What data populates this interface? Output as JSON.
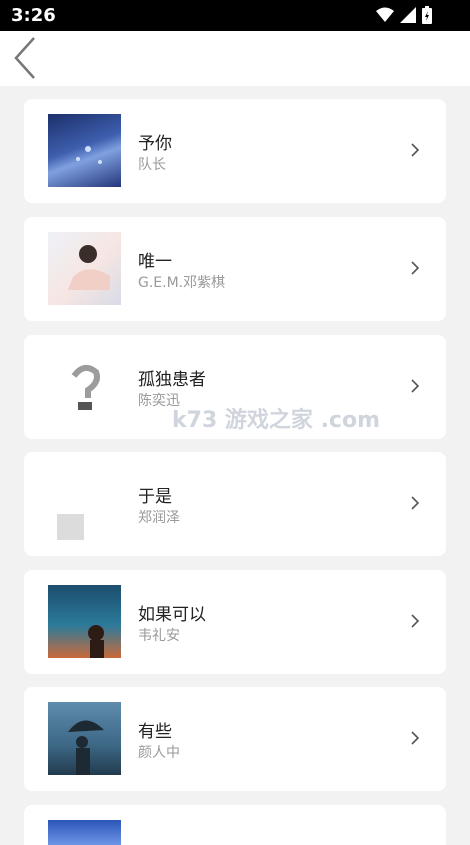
{
  "status": {
    "time": "3:26"
  },
  "songs": [
    {
      "title": "予你",
      "artist": "队长"
    },
    {
      "title": "唯一",
      "artist": "G.E.M.邓紫棋"
    },
    {
      "title": "孤独患者",
      "artist": "陈奕迅"
    },
    {
      "title": "于是",
      "artist": "郑润泽"
    },
    {
      "title": "如果可以",
      "artist": "韦礼安"
    },
    {
      "title": "有些",
      "artist": "颜人中"
    }
  ],
  "watermark": "k73 游戏之家 .com"
}
